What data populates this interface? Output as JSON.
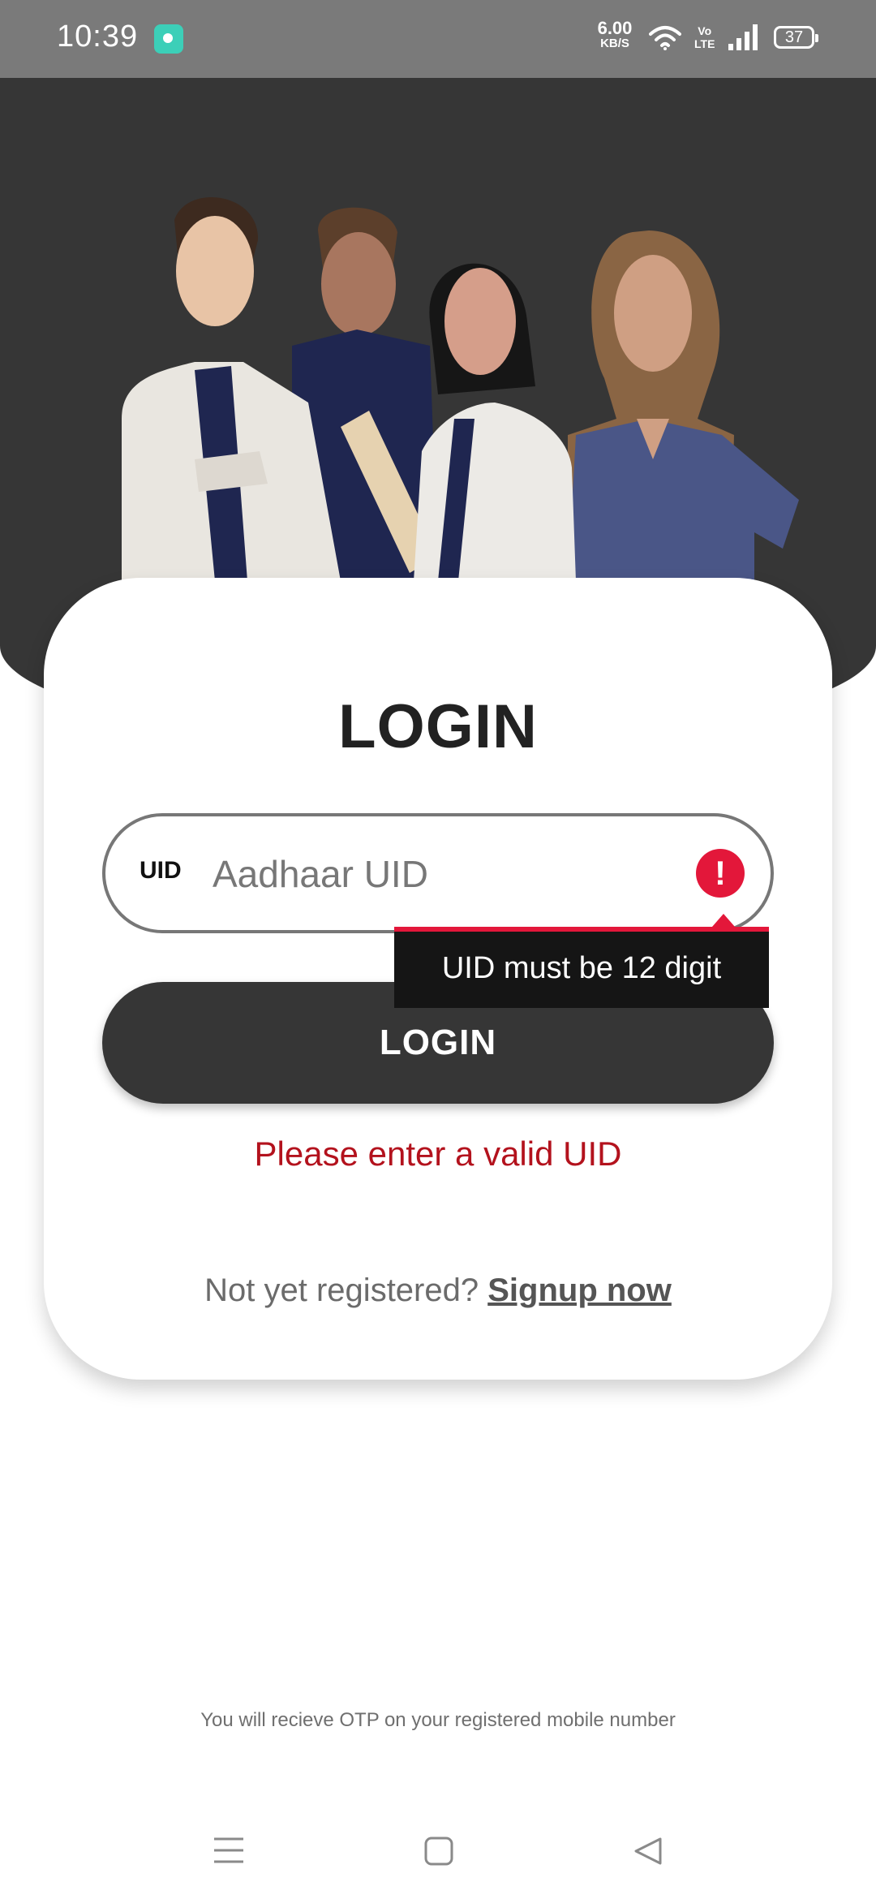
{
  "status_bar": {
    "time": "10:39",
    "net_speed_value": "6.00",
    "net_speed_unit": "KB/S",
    "volte_line1": "Vo",
    "volte_line2": "LTE",
    "battery": "37"
  },
  "login": {
    "title": "LOGIN",
    "uid_badge": "UID",
    "uid_placeholder": "Aadhaar UID",
    "uid_value": "",
    "error_icon": "!",
    "tooltip": "UID must be 12 digit",
    "button_label": "LOGIN",
    "validation_message": "Please enter a valid UID",
    "signup_prompt": "Not yet registered? ",
    "signup_link": "Signup now"
  },
  "footer": {
    "otp_note": "You will recieve OTP on your registered mobile number"
  },
  "colors": {
    "header_dark": "#363636",
    "error_red": "#e3173a",
    "validation_red": "#b3121d",
    "status_bar": "#7a7a7a"
  },
  "icons": {
    "status_app": "app-notification-icon",
    "wifi": "wifi-icon",
    "signal": "signal-icon",
    "battery": "battery-icon",
    "error": "error-icon",
    "nav_menu": "menu-icon",
    "nav_home": "home-icon",
    "nav_back": "back-icon"
  }
}
